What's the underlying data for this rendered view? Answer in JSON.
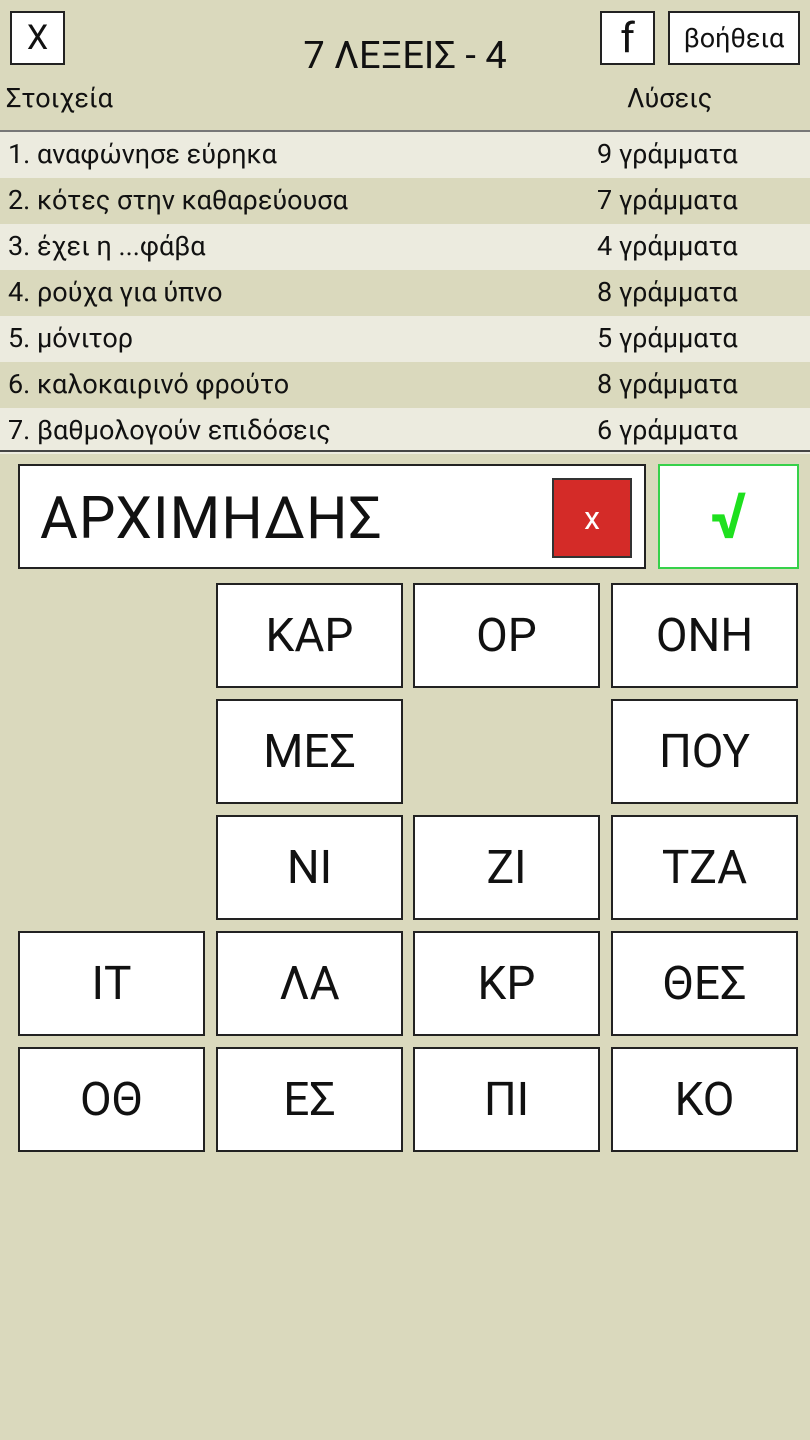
{
  "header": {
    "close_label": "X",
    "facebook_label": "f",
    "help_label": "βοήθεια",
    "title": "7 ΛΕΞΕΙΣ - 4",
    "col_clues": "Στοιχεία",
    "col_solutions": "Λύσεις"
  },
  "clues": [
    {
      "text": "1. αναφώνησε εύρηκα",
      "solution": "9 γράμματα"
    },
    {
      "text": "2. κότες στην καθαρεύουσα",
      "solution": "7 γράμματα"
    },
    {
      "text": "3. έχει η ...φάβα",
      "solution": "4 γράμματα"
    },
    {
      "text": "4. ρούχα για ύπνο",
      "solution": "8 γράμματα"
    },
    {
      "text": "5. μόνιτορ",
      "solution": "5 γράμματα"
    },
    {
      "text": "6. καλοκαιρινό φρούτο",
      "solution": "8 γράμματα"
    },
    {
      "text": "7. βαθμολογούν επιδόσεις",
      "solution": "6 γράμματα"
    }
  ],
  "answer": {
    "value": "ΑΡΧΙΜΗΔΗΣ",
    "clear_label": "x",
    "check_label": "√"
  },
  "tiles": [
    [
      "",
      "ΚΑΡ",
      "ΟΡ",
      "ΟΝΗ"
    ],
    [
      "",
      "ΜΕΣ",
      "",
      "ΠΟΥ"
    ],
    [
      "",
      "ΝΙ",
      "ΖΙ",
      "ΤΖΑ"
    ],
    [
      "ΙΤ",
      "ΛΑ",
      "ΚΡ",
      "ΘΕΣ"
    ],
    [
      "ΟΘ",
      "ΕΣ",
      "ΠΙ",
      "ΚΟ"
    ]
  ],
  "colors": {
    "background": "#dad9bd",
    "row_light": "#ecebdf",
    "clear_button": "#d42b28",
    "check_border": "#36d14a",
    "check_mark": "#1ee01e"
  }
}
